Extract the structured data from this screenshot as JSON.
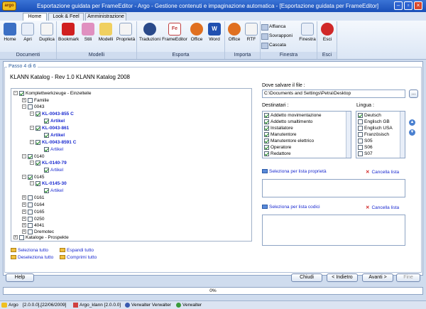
{
  "window": {
    "title": "Esportazione guidata per FrameEditor - Argo - Gestione contenuti e impaginazione automatica - [Esportazione guidata per FrameEditor]",
    "logo_text": "argo"
  },
  "tabs": [
    "Home",
    "Look & Feel",
    "Amministrazione"
  ],
  "ribbon": {
    "groups": [
      "Documenti",
      "Modelli",
      "Esporta",
      "Importa",
      "Finestra",
      "Esci"
    ],
    "buttons": [
      "Home",
      "Apri",
      "Duplica",
      "Bookmark",
      "Stili",
      "Modelli",
      "Proprietà",
      "Traduzioni",
      "FrameEditor",
      "Office",
      "Word",
      "Office",
      "RTF",
      "Finestra",
      "Esci"
    ],
    "small": [
      "Affianca",
      "Sovrapponi",
      "Cascata"
    ]
  },
  "wizard": {
    "step": "Passo 4 di 6",
    "header": "KLANN Katalog - Rev 1.0 KLANN Katalog 2008",
    "tree": [
      {
        "label": "Komplettwerkzeuge - Einzelteile"
      },
      {
        "label": "Familie"
      },
      {
        "label": "0043"
      },
      {
        "label": "KL-0043-855 C"
      },
      {
        "label": "Artikel"
      },
      {
        "label": "KL-0043-861"
      },
      {
        "label": "Artikel"
      },
      {
        "label": "KL-0043-8591 C"
      },
      {
        "label": "Artikel"
      },
      {
        "label": "0140"
      },
      {
        "label": "KL-0140-79"
      },
      {
        "label": "Artikel"
      },
      {
        "label": "0145"
      },
      {
        "label": "KL-0145-30"
      },
      {
        "label": "Artikel"
      },
      {
        "label": "0161"
      },
      {
        "label": "0164"
      },
      {
        "label": "0165"
      },
      {
        "label": "0250"
      },
      {
        "label": "4041"
      },
      {
        "label": "Dremotec"
      },
      {
        "label": "Kataloge - Prospekte"
      }
    ],
    "links": {
      "select_all": "Seleziona tutto",
      "expand_all": "Espandi tutto",
      "deselect_all": "Deseleziona tutto",
      "collapse_all": "Comprimi tutto"
    },
    "save_label": "Dove salvare il file :",
    "save_path": "C:\\Documents and Settings\\Petra\\Desktop",
    "browse": "...",
    "recipients_label": "Destinatari :",
    "recipients": [
      "Addetto movimentazione",
      "Addetto smaltimento",
      "Installatore",
      "Manutentore",
      "Manutentore elettrico",
      "Operatore",
      "Redattore"
    ],
    "language_label": "Lingua :",
    "languages": [
      "Deutsch",
      "Englisch GB",
      "Englisch USA",
      "Französisch",
      "S05",
      "S06",
      "S07"
    ],
    "select_by_property": "Seleziona per lista proprietà",
    "select_by_codes": "Seleziona per lista codici",
    "cancel_list": "Cancella lista"
  },
  "footer": {
    "help": "Help",
    "close": "Chiudi",
    "back": "< Indietro",
    "next": "Avanti >",
    "finish": "Fine",
    "progress": "0%"
  },
  "status": [
    "Argo",
    "[2.0.0.0],[22/06/2009]",
    "Argo_klann [2.0.0.0]",
    "Verwalter Verwalter",
    "Verwalter"
  ]
}
